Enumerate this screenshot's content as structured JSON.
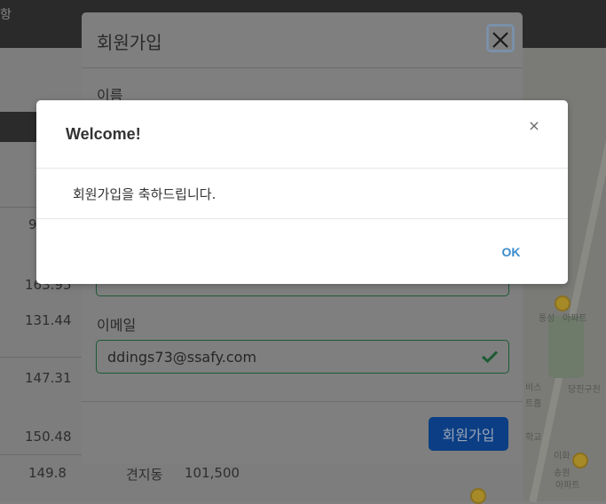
{
  "background": {
    "header_text": "항",
    "table_values": [
      "9",
      "163.95",
      "131.44",
      "147.31",
      "150.48",
      "149.8"
    ],
    "bottom_row": {
      "area": "149.8",
      "dong": "견지동",
      "price": "101,500"
    },
    "map_labels": [
      "통성",
      "아파트",
      "비스",
      "트홈",
      "학교",
      "이화",
      "송원",
      "아파트",
      "당진구천"
    ]
  },
  "signup_modal": {
    "title": "회원가입",
    "name_label": "이름",
    "email_label": "이메일",
    "email_value": "ddings73@ssafy.com",
    "submit_label": "회원가입",
    "close_icon": "close-icon",
    "valid_icon": "check-icon"
  },
  "welcome_dialog": {
    "title": "Welcome!",
    "close_symbol": "×",
    "message": "회원가입을 축하드립니다.",
    "ok_label": "OK"
  },
  "colors": {
    "overlay": "#808080",
    "valid_green": "#1c5a34",
    "primary_button": "#0b3e84",
    "ok_link": "#3b8dcc"
  }
}
